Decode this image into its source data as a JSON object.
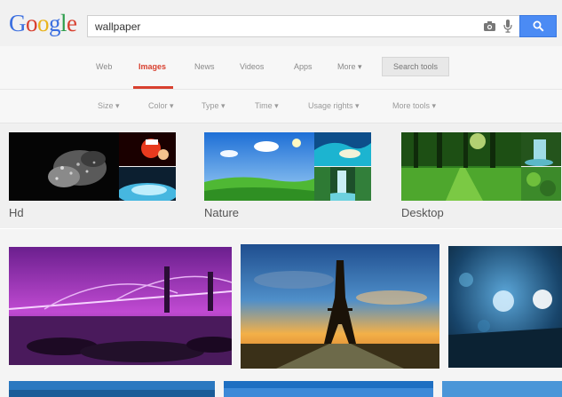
{
  "logo": {
    "letters": [
      "G",
      "o",
      "o",
      "g",
      "l",
      "e"
    ],
    "colors": [
      "#3b6fe0",
      "#d8402f",
      "#e9b31c",
      "#3b6fe0",
      "#2f9e4d",
      "#d8402f"
    ]
  },
  "search": {
    "query": "wallpaper",
    "camera_icon": "camera-icon",
    "mic_icon": "mic-icon",
    "button_icon": "search-icon",
    "button_color": "#4b8bf4"
  },
  "nav": {
    "items": [
      "Web",
      "Images",
      "News",
      "Videos",
      "Apps",
      "More ▾"
    ],
    "active": "Images",
    "search_tools": "Search tools",
    "accent": "#d8402f"
  },
  "filters": [
    "Size ▾",
    "Color ▾",
    "Type ▾",
    "Time ▾",
    "Usage rights ▾",
    "More tools ▾"
  ],
  "related": [
    {
      "label": "Hd"
    },
    {
      "label": "Nature"
    },
    {
      "label": "Desktop"
    }
  ],
  "results": [
    {
      "subject": "purple lit bridge at night"
    },
    {
      "subject": "Eiffel tower at sunset"
    },
    {
      "subject": "blue bokeh lights"
    }
  ]
}
